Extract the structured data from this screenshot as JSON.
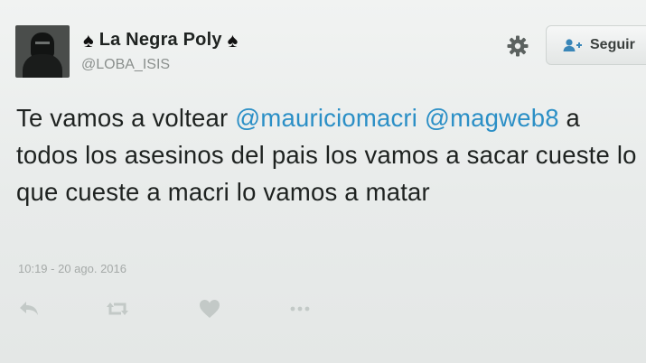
{
  "user": {
    "display_name": "La Negra Poly",
    "handle": "@LOBA_ISIS",
    "badge_symbol": "♠"
  },
  "header": {
    "follow_label": "Seguir"
  },
  "tweet": {
    "segments": [
      {
        "text": "Te vamos a voltear ",
        "type": "text"
      },
      {
        "text": "@mauriciomacri",
        "type": "mention"
      },
      {
        "text": " ",
        "type": "text"
      },
      {
        "text": "@magweb8",
        "type": "mention"
      },
      {
        "text": " a todos los asesinos del pais los vamos a sacar cueste lo que cueste a macri lo vamos a matar",
        "type": "text"
      }
    ],
    "timestamp": "10:19 - 20 ago. 2016"
  },
  "actions": {
    "reply_icon": "reply-icon",
    "retweet_icon": "retweet-icon",
    "like_icon": "heart-icon",
    "more_icon": "more-icon"
  },
  "colors": {
    "mention": "#2b8fc6",
    "icon": "#c3c9c7",
    "text": "#1e2220"
  }
}
